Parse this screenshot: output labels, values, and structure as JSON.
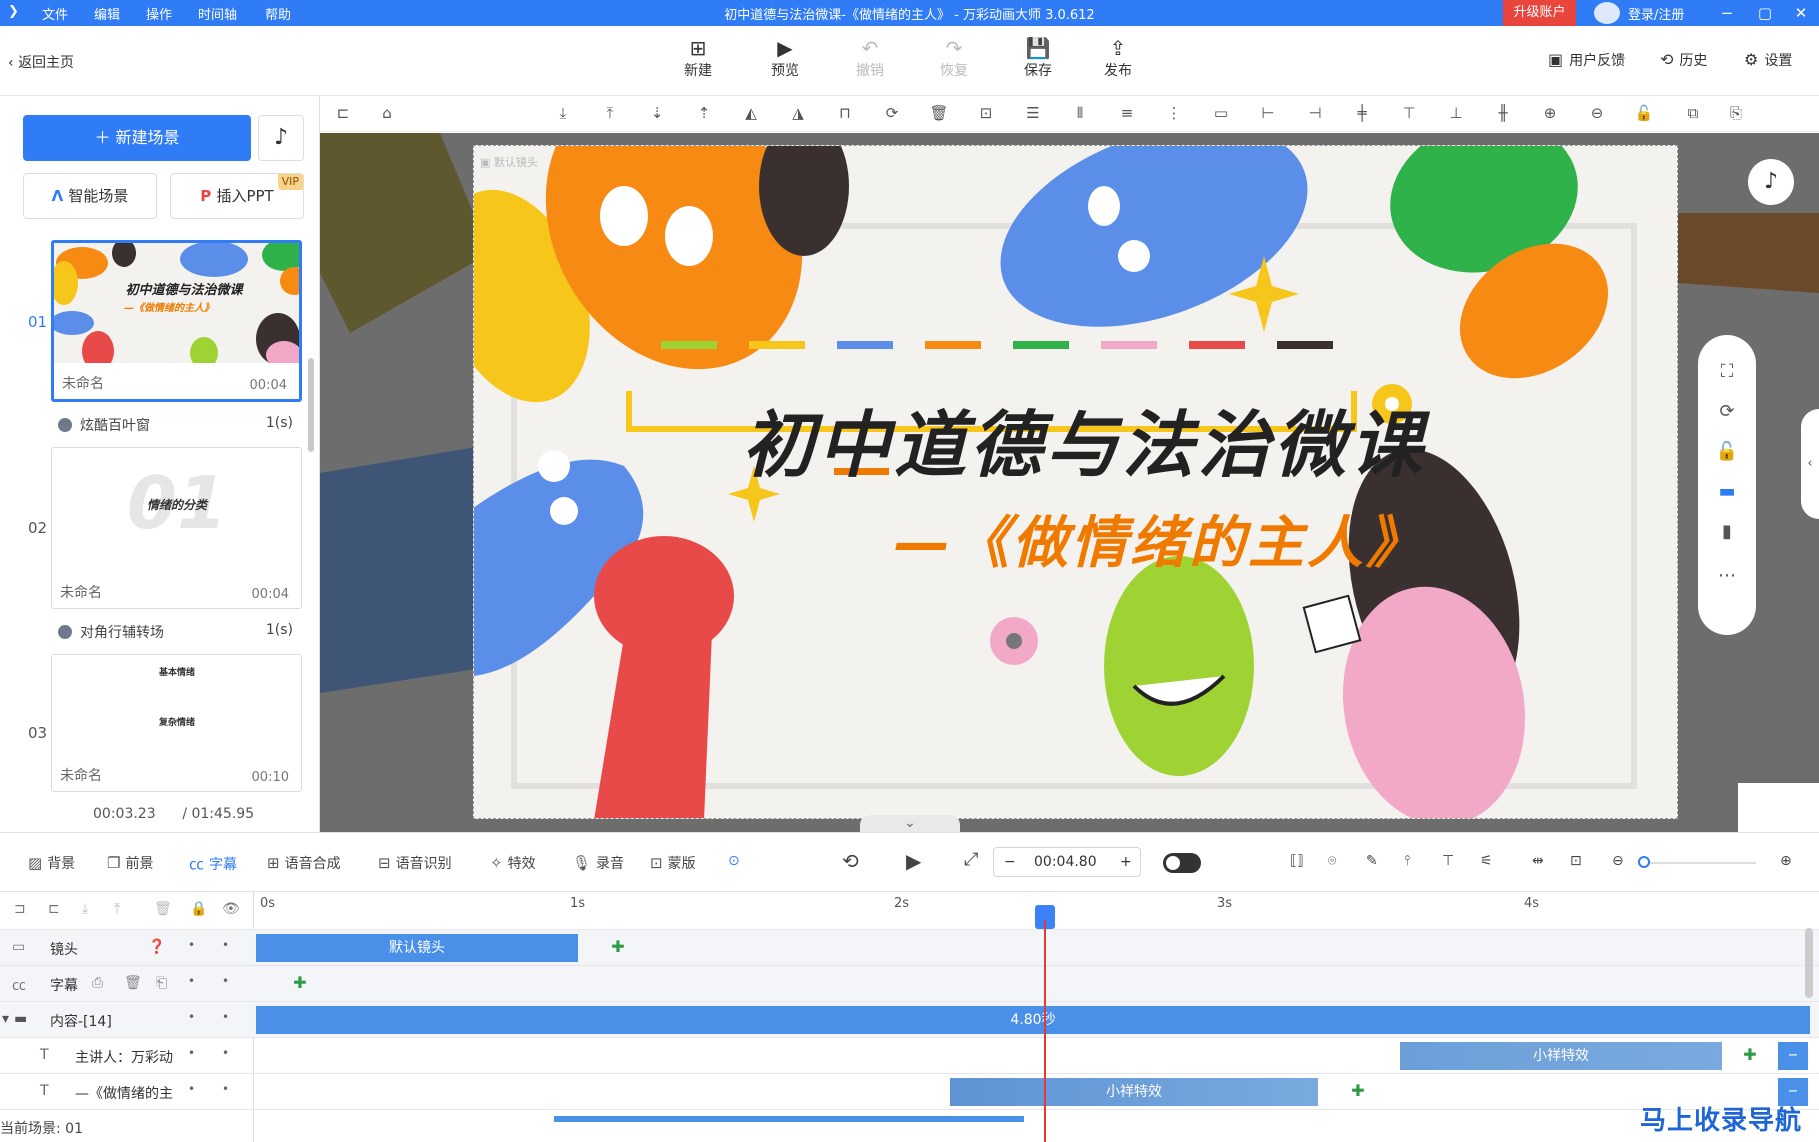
{
  "titlebar": {
    "menus": [
      "文件",
      "编辑",
      "操作",
      "时间轴",
      "帮助"
    ],
    "window_title": "初中道德与法治微课-《做情绪的主人》 - 万彩动画大师 3.0.612",
    "upgrade_label": "升级账户",
    "login_label": "登录/注册",
    "accent": "#2f7cf6"
  },
  "toolbar": {
    "back_label": "返回主页",
    "buttons": [
      {
        "label": "新建",
        "icon": "new-icon",
        "enabled": true
      },
      {
        "label": "预览",
        "icon": "play-icon",
        "enabled": true
      },
      {
        "label": "撤销",
        "icon": "undo-icon",
        "enabled": false
      },
      {
        "label": "恢复",
        "icon": "redo-icon",
        "enabled": false
      },
      {
        "label": "保存",
        "icon": "save-icon",
        "enabled": true
      },
      {
        "label": "发布",
        "icon": "publish-icon",
        "enabled": true
      }
    ],
    "right": {
      "feedback": "用户反馈",
      "history": "历史",
      "settings": "设置"
    }
  },
  "sidebar": {
    "new_scene": "新建场景",
    "smart_scene": "智能场景",
    "insert_ppt": "插入PPT",
    "vip": "VIP",
    "scenes": [
      {
        "number": "01",
        "name": "未命名",
        "duration": "00:04",
        "transition": "炫酷百叶窗",
        "transition_time": "1(s)",
        "thumb_title": "初中道德与法治微课",
        "thumb_sub": "—《做情绪的主人》"
      },
      {
        "number": "02",
        "name": "未命名",
        "duration": "00:04",
        "transition": "对角行辅转场",
        "transition_time": "1(s)",
        "thumb_big": "01",
        "thumb_sub": "情绪的分类"
      },
      {
        "number": "03",
        "name": "未命名",
        "duration": "00:10",
        "thumb_title": "基本情绪",
        "thumb_sub": "复杂情绪"
      }
    ],
    "current_time": "00:03.23",
    "total_time": "/ 01:45.95"
  },
  "stage": {
    "camera_label": "默认镜头",
    "title": "初中道德与法治微课",
    "subtitle": "—《做情绪的主人》",
    "color_dashes": [
      "#9fd233",
      "#f7c61a",
      "#5a8ee8",
      "#f78a12",
      "#2fb24a",
      "#f2a9c8",
      "#e84a4a",
      "#3a3030"
    ]
  },
  "bottom_tools": {
    "items": [
      {
        "label": "背景",
        "icon": "background-icon",
        "active": false
      },
      {
        "label": "前景",
        "icon": "foreground-icon",
        "active": false
      },
      {
        "label": "字幕",
        "icon": "subtitle-icon",
        "active": true
      },
      {
        "label": "语音合成",
        "icon": "tts-icon",
        "active": false
      },
      {
        "label": "语音识别",
        "icon": "speech-recognition-icon",
        "active": false
      },
      {
        "label": "特效",
        "icon": "effects-icon",
        "active": false
      },
      {
        "label": "录音",
        "icon": "microphone-icon",
        "active": false
      },
      {
        "label": "蒙版",
        "icon": "mask-icon",
        "active": false
      }
    ],
    "time_value": "00:04.80",
    "minus": "−",
    "plus": "+"
  },
  "timeline": {
    "ruler": [
      "0s",
      "1s",
      "2s",
      "3s",
      "4s"
    ],
    "tracks": [
      {
        "label": "镜头",
        "bar": "默认镜头"
      },
      {
        "label": "字幕"
      },
      {
        "label": "内容-[14]",
        "bar": "4.80秒"
      },
      {
        "label": "主讲人：万彩动",
        "bar": "小祥特效"
      },
      {
        "label": "—《做情绪的主",
        "bar": "小祥特效"
      }
    ],
    "dot": "•"
  },
  "status": {
    "current_scene": "当前场景: 01"
  },
  "watermark": "马上收录导航"
}
